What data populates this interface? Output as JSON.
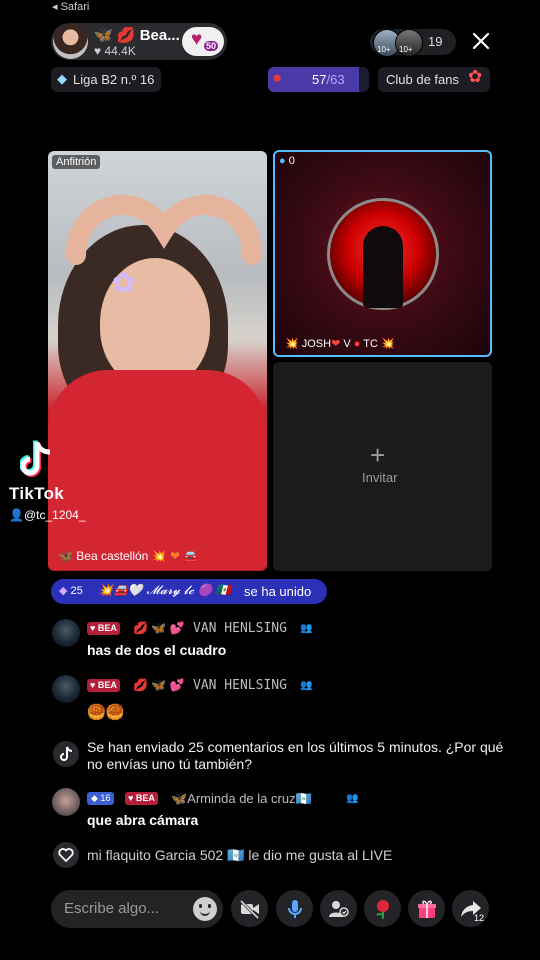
{
  "status": {
    "back_label": "◂ Safari"
  },
  "host": {
    "name": "Bea...",
    "emoji_prefix": "🦋",
    "emoji_heart": "💋",
    "likes": "♥ 44.4K",
    "badge_level": "50"
  },
  "viewers": {
    "avatar1_rank": "10+",
    "avatar2_rank": "10+",
    "count": "19"
  },
  "league": {
    "label": "Liga B2 n.º 16"
  },
  "goal": {
    "current": "57",
    "sep": "/",
    "max": "63",
    "progress": 0.905
  },
  "fans": {
    "label": "Club de fans"
  },
  "host_video": {
    "label": "Anfitrión",
    "name_prefix": "🦋 ",
    "name": "Bea castellón",
    "name_suffix": " 💥 ❤ 🚘"
  },
  "guest": {
    "score": "0",
    "name_left": "💥 JOSH",
    "heart": "❤",
    "middle": " V ",
    "right": "TC 💥"
  },
  "invite": {
    "plus": "+",
    "label": "Invitar"
  },
  "watermark": {
    "brand": "TikTok",
    "user": "@tc_1204_"
  },
  "joined": {
    "level": "25",
    "deco_name": "💥🚘🤍 𝓜𝓪𝓻𝔂 𝓵𝓬 🟣 🇲🇽",
    "text": "se ha unido"
  },
  "chat": [
    {
      "badge": "♥ BEA",
      "deco": "💋 🦋 💕",
      "user": "VAN HENLSING",
      "message": "has de dos el cuadro"
    },
    {
      "badge": "♥ BEA",
      "deco": "💋 🦋 💕",
      "user": "VAN HENLSING",
      "message": "🥮🥮"
    }
  ],
  "system_message": "Se han enviado 25 comentarios en los últimos 5 minutos. ¿Por qué no envías uno tú también?",
  "chat3": {
    "level": "16",
    "badge": "♥ BEA",
    "user": "🦋Arminda de la cruz🇬🇹",
    "message": "que abra cámara"
  },
  "like_notice": "mi flaquito Garcia 502 🇬🇹 le dio me gusta al LIVE",
  "input": {
    "placeholder": "Escribe algo..."
  },
  "share_count": "12",
  "colors": {
    "accent": "#55bcff",
    "goal": "#4a3aa8",
    "joined_bg": "#2a30b8",
    "badge_red": "#b4203a"
  },
  "icons": [
    "close-icon",
    "heart-icon",
    "diamond-icon",
    "camera-off-icon",
    "mic-icon",
    "people-icon",
    "rose-icon",
    "gift-icon",
    "share-icon",
    "emoji-icon",
    "tiktok-logo"
  ]
}
